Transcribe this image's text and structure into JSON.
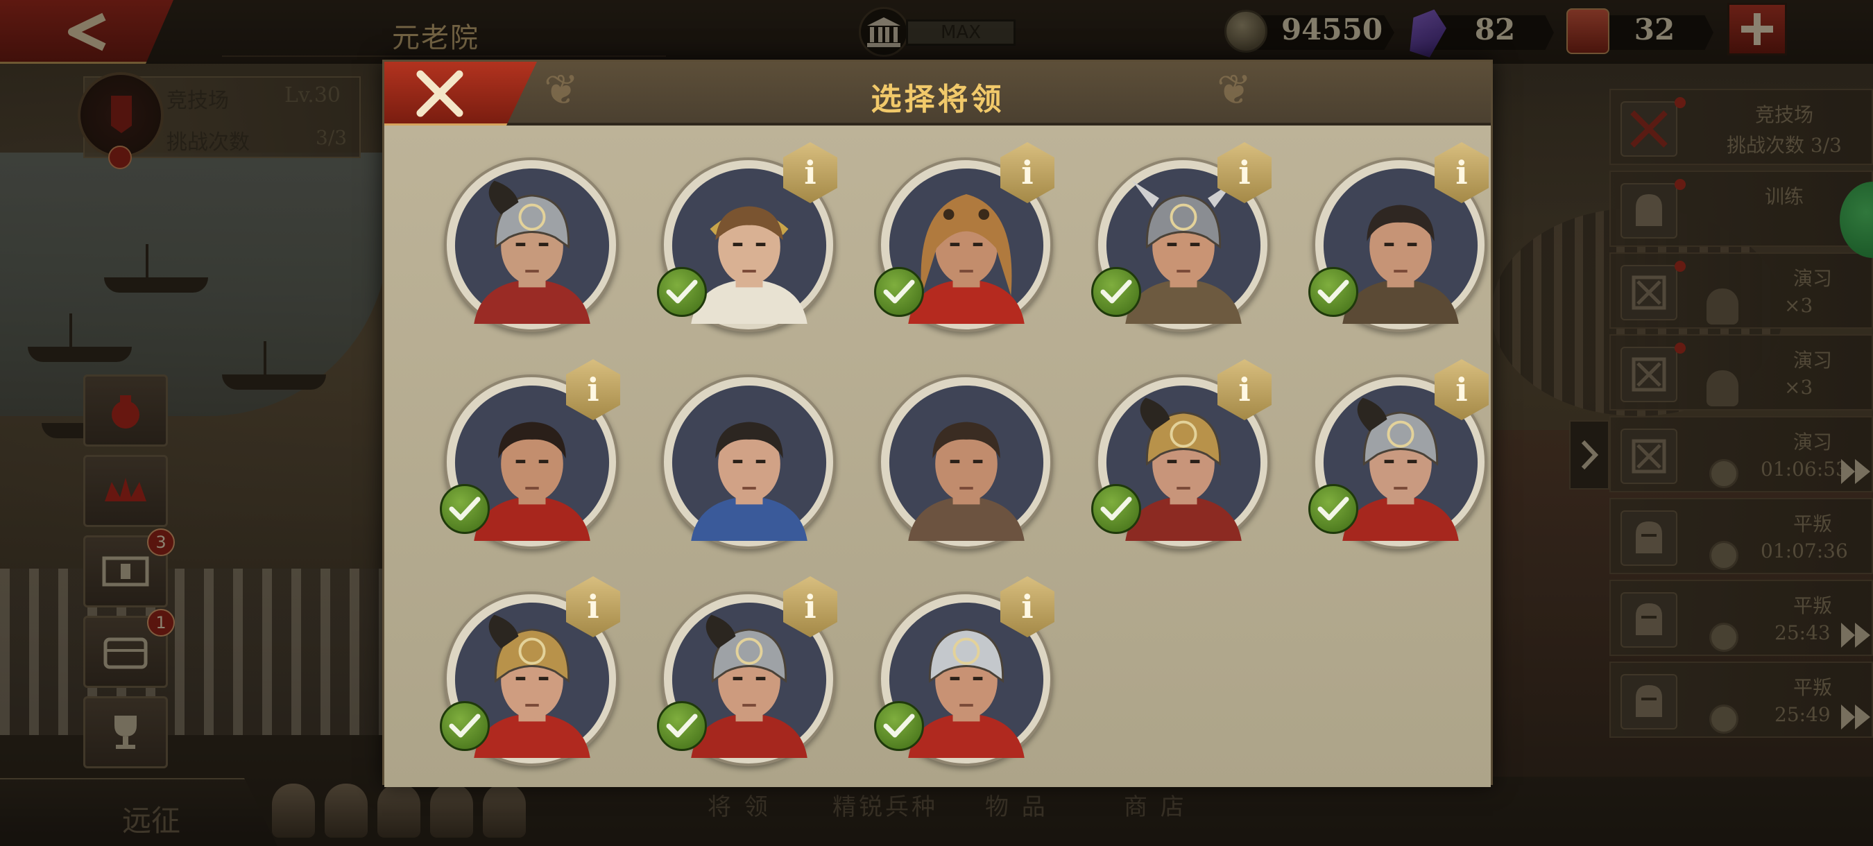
{
  "topbar": {
    "senate_title": "元老院",
    "building_level": "MAX",
    "coins": "94550",
    "gems": "82",
    "tokens": "32"
  },
  "arena": {
    "name": "竞技场",
    "level": "Lv.30",
    "challenges_label": "挑战次数",
    "challenges_value": "3/3"
  },
  "side_badges": {
    "video": "3",
    "chest": "1"
  },
  "expedition_label": "远征",
  "bottom_tabs": [
    "将 领",
    "精锐兵种",
    "物 品",
    "商 店"
  ],
  "tasks": [
    {
      "title": "竞技场",
      "sub": "挑战次数 3/3"
    },
    {
      "title": "训练",
      "sub": ""
    },
    {
      "title": "演习",
      "sub": "×3"
    },
    {
      "title": "演习",
      "sub": "×3"
    },
    {
      "title": "演习",
      "sub": "01:06:53"
    },
    {
      "title": "平叛",
      "sub": "01:07:36"
    },
    {
      "title": "平叛",
      "sub": "25:43"
    },
    {
      "title": "平叛",
      "sub": "25:49"
    }
  ],
  "modal": {
    "title": "选择将领",
    "info_label": "i",
    "generals": [
      {
        "id": "roman-helmet-officer",
        "has_info": false,
        "selected": false,
        "skin": "#c79a7c",
        "hair": "#3a2a20",
        "helmet": "silver",
        "cloth": "#9a2b25"
      },
      {
        "id": "laurel-youth",
        "has_info": true,
        "selected": true,
        "skin": "#d9b193",
        "hair": "#7a5430",
        "helmet": "laurel",
        "cloth": "#e8e2d2"
      },
      {
        "id": "lion-pelt-warrior",
        "has_info": true,
        "selected": true,
        "skin": "#c38d6c",
        "hair": "#8a6236",
        "helmet": "lion",
        "cloth": "#b52a1f"
      },
      {
        "id": "winged-helmet-chief",
        "has_info": true,
        "selected": true,
        "skin": "#c99474",
        "hair": "#a98450",
        "helmet": "winged",
        "cloth": "#6d5a40"
      },
      {
        "id": "bearded-commander",
        "has_info": true,
        "selected": true,
        "skin": "#c69476",
        "hair": "#2f2722",
        "helmet": "none",
        "cloth": "#5b4a35"
      },
      {
        "id": "red-cloak-veteran",
        "has_info": true,
        "selected": true,
        "skin": "#c38e6e",
        "hair": "#2a1f19",
        "helmet": "none",
        "cloth": "#a8261d"
      },
      {
        "id": "blue-tunic-officer",
        "has_info": false,
        "selected": false,
        "skin": "#d1a286",
        "hair": "#2c2621",
        "helmet": "none",
        "cloth": "#3a5a9a"
      },
      {
        "id": "fur-collar-lord",
        "has_info": false,
        "selected": false,
        "skin": "#c18c6d",
        "hair": "#3a2c22",
        "helmet": "none",
        "cloth": "#6c5340"
      },
      {
        "id": "gold-helmet-legate",
        "has_info": true,
        "selected": true,
        "skin": "#c8957a",
        "hair": "#2d231d",
        "helmet": "gold",
        "cloth": "#8c2a22"
      },
      {
        "id": "black-crest-centurion",
        "has_info": true,
        "selected": true,
        "skin": "#c99a80",
        "hair": "#2d231d",
        "helmet": "silver",
        "cloth": "#a6271e"
      },
      {
        "id": "white-crest-tribune",
        "has_info": true,
        "selected": true,
        "skin": "#cf9d80",
        "hair": "#2d231d",
        "helmet": "gold",
        "cloth": "#b0291f"
      },
      {
        "id": "red-crest-centurion",
        "has_info": true,
        "selected": true,
        "skin": "#cd9b7e",
        "hair": "#2d231d",
        "helmet": "silver",
        "cloth": "#a6271e"
      },
      {
        "id": "steel-helm-knight",
        "has_info": true,
        "selected": true,
        "skin": "#c89274",
        "hair": "#2a1f19",
        "helmet": "steel",
        "cloth": "#b0291f"
      }
    ]
  },
  "colors": {
    "accent_red": "#a2261c",
    "gold_text": "#f1c96a",
    "check_green": "#5a8a2a",
    "modal_bg": "#b3a98f"
  }
}
